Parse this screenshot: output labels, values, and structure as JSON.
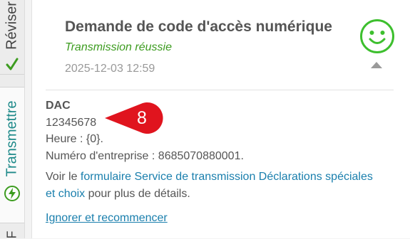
{
  "sidebar": {
    "tabs": [
      {
        "label": "Réviser",
        "icon": "check-icon"
      },
      {
        "label": "Transmettre",
        "icon": "lightning-icon"
      },
      {
        "label": "F"
      }
    ]
  },
  "card": {
    "title": "Demande de code d'accès numérique",
    "status": "Transmission réussie",
    "datetime": "2025-12-03 12:59",
    "status_icon": "smiley-icon",
    "collapse_icon": "chevron-up-icon",
    "code_label": "DAC",
    "code_value": "12345678",
    "time_line": "Heure : {0}.",
    "business_number_line": "Numéro d'entreprise : 8685070880001.",
    "info_prefix": "Voir le ",
    "info_link": "formulaire Service de transmission Déclarations spéciales et choix",
    "info_suffix": " pour plus de détails.",
    "restart_link": "Ignorer et recommencer"
  },
  "callout": {
    "number": "8"
  },
  "colors": {
    "accent_green": "#3d9c20",
    "link_blue": "#1a7fad",
    "teal": "#1f8a8a",
    "callout_red": "#e0141e"
  }
}
